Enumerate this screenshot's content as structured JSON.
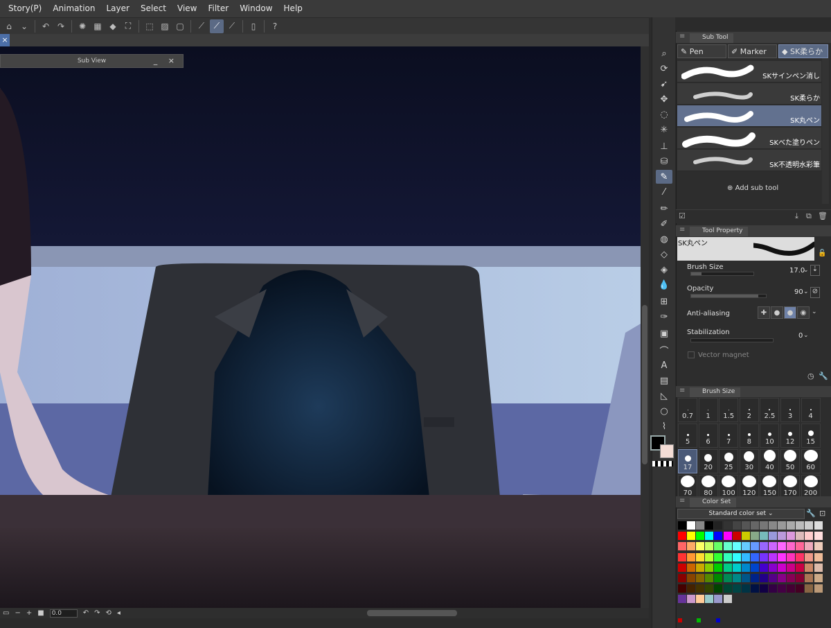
{
  "menubar": [
    "Story(P)",
    "Animation",
    "Layer",
    "Select",
    "View",
    "Filter",
    "Window",
    "Help"
  ],
  "subview": {
    "title": "Sub View",
    "controls": "_ ×"
  },
  "canvas_tab_close": "×",
  "bottombar": {
    "zoom_value": "0.0"
  },
  "panels": {
    "subtool_title": "Sub Tool",
    "toolproperty_title": "Tool Property",
    "brushsize_title": "Brush Size",
    "colorset_title": "Color Set"
  },
  "subtool": {
    "tabs": [
      "Pen",
      "Marker",
      "SK柔らか"
    ],
    "active_tab": 2,
    "brushes": [
      "SKサインペン消し",
      "SK柔らか",
      "SK丸ペン",
      "SKべた塗りペン",
      "SK不透明水彩筆"
    ],
    "selected_brush": 2,
    "add_label": "Add sub tool"
  },
  "toolproperty": {
    "preview_name": "SK丸ペン",
    "brush_size_label": "Brush Size",
    "brush_size_value": "17.0",
    "brush_size_fill": 0.17,
    "opacity_label": "Opacity",
    "opacity_value": "90",
    "opacity_fill": 0.9,
    "antialias_label": "Anti-aliasing",
    "antialias_selected": 2,
    "stabilization_label": "Stabilization",
    "stabilization_value": "0",
    "vector_magnet_label": "Vector magnet"
  },
  "brushsize": {
    "sizes": [
      "0.7",
      "1",
      "1.5",
      "2",
      "2.5",
      "3",
      "4",
      "5",
      "6",
      "7",
      "8",
      "10",
      "12",
      "15",
      "17",
      "20",
      "25",
      "30",
      "40",
      "50",
      "60",
      "70",
      "80",
      "100",
      "120",
      "150",
      "170",
      "200"
    ],
    "selected": "17"
  },
  "colorset": {
    "dropdown_value": "Standard color set"
  },
  "colors": {
    "accent": "#5b6a85",
    "foreground": "#000000",
    "background": "#f4ddd6"
  },
  "icons": {
    "toolbox": [
      "zoom-icon",
      "rotate-icon",
      "operation-icon",
      "move-icon",
      "lasso-icon",
      "magic-wand-icon",
      "stamp-icon",
      "fill-tool-icon",
      "pen-icon",
      "eyedropper-icon",
      "pencil-icon",
      "marker-icon",
      "blend-icon",
      "eraser-icon",
      "fill-icon",
      "drop-icon",
      "mesh-icon",
      "pen-nib-icon",
      "gradient-icon",
      "curve-icon",
      "text-icon",
      "layers-icon",
      "ruler-icon",
      "balloon-icon",
      "brush-icon"
    ]
  }
}
